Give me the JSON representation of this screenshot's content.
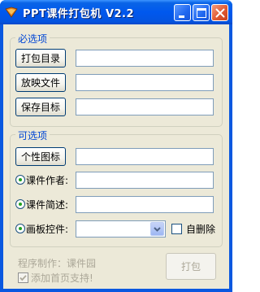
{
  "window": {
    "title": "PPT课件打包机 V2.2",
    "icons": {
      "app": "ppt-app-icon",
      "minimize": "minimize-icon",
      "maximize": "maximize-icon",
      "close": "close-icon"
    }
  },
  "required_group": {
    "title": "必选项",
    "package_dir_button": "打包目录",
    "package_dir_value": "",
    "slideshow_file_button": "放映文件",
    "slideshow_file_value": "",
    "save_target_button": "保存目标",
    "save_target_value": ""
  },
  "optional_group": {
    "title": "可选项",
    "custom_icon_button": "个性图标",
    "custom_icon_value": "",
    "author_label": "课件作者:",
    "author_value": "",
    "description_label": "课件简述:",
    "description_value": "",
    "drawing_board_label": "画板控件:",
    "drawing_board_value": "",
    "auto_delete_label": "自删除",
    "auto_delete_checked": false
  },
  "footer": {
    "credit": "程序制作：课件园",
    "add_homepage_label": "添加首页支持!",
    "add_homepage_checked": true,
    "pack_button": "打包"
  },
  "colors": {
    "titlebar": "#0058ee",
    "client_background": "#ece9d8",
    "group_title": "#0046d5",
    "disabled_text": "#aca899"
  }
}
